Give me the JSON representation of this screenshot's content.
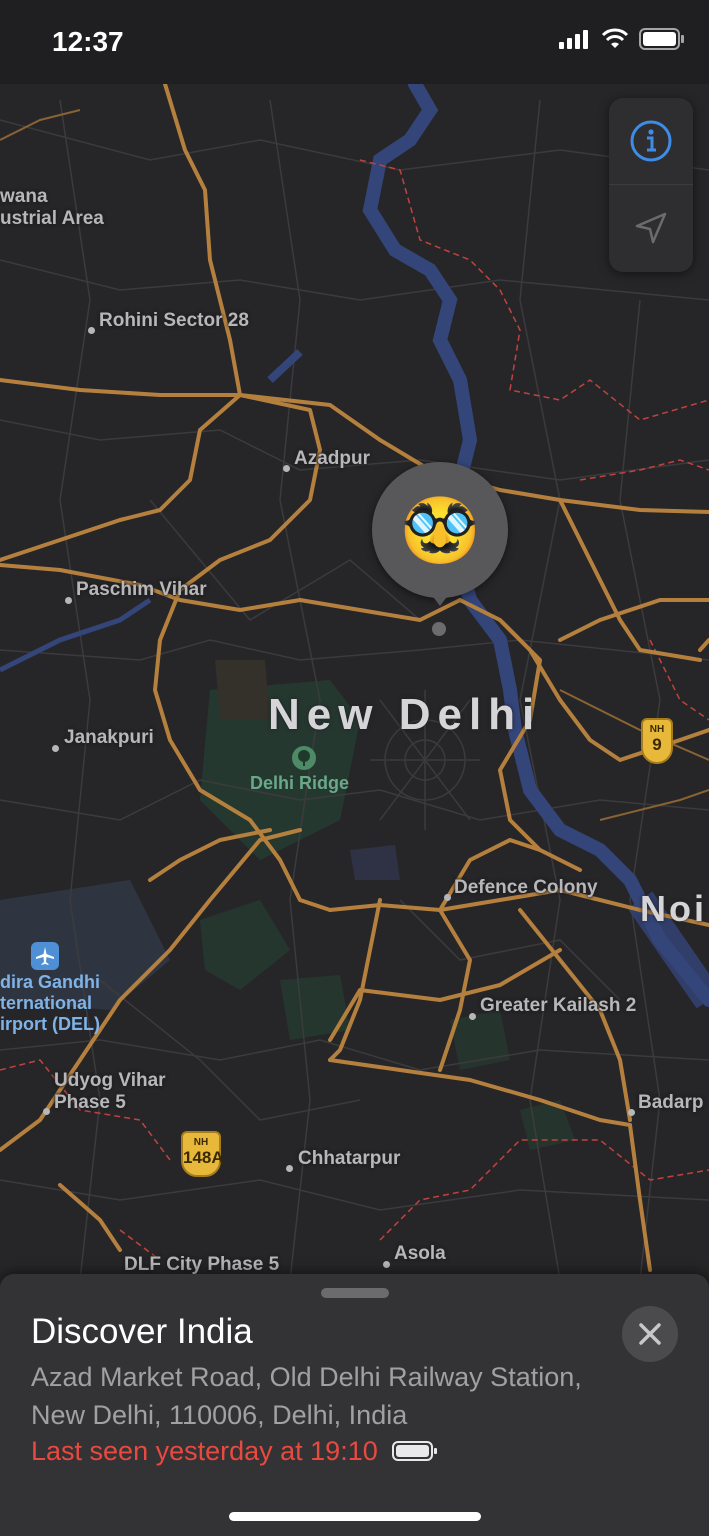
{
  "status_bar": {
    "time": "12:37"
  },
  "map": {
    "city_label": "New Delhi",
    "edge_label": "Noi",
    "places": [
      {
        "name": "wana\nustrial Area"
      },
      {
        "name": "Rohini Sector 28"
      },
      {
        "name": "Azadpur"
      },
      {
        "name": "Paschim Vihar"
      },
      {
        "name": "Janakpuri"
      },
      {
        "name": "Defence Colony"
      },
      {
        "name": "Greater Kailash 2"
      },
      {
        "name": "Udyog Vihar\nPhase 5"
      },
      {
        "name": "Chhatarpur"
      },
      {
        "name": "Badarp"
      },
      {
        "name": "Asola"
      },
      {
        "name": "DLF City Phase 5"
      }
    ],
    "park_label": "Delhi Ridge",
    "airport_label": "dira Gandhi\nternational\nirport (DEL)",
    "highway_shields": [
      {
        "prefix": "NH",
        "number": "9"
      },
      {
        "prefix": "NH",
        "number": "148A"
      }
    ],
    "pin_emoji": "🥸",
    "controls": {
      "info_icon": "info-icon",
      "location_icon": "location-arrow-icon"
    }
  },
  "sheet": {
    "title": "Discover India",
    "address": "Azad Market Road, Old Delhi Railway Station, New Delhi, 110006, Delhi, India",
    "last_seen": "Last seen yesterday at 19:10",
    "close_icon": "close-icon"
  },
  "colors": {
    "road": "#b5803e",
    "river": "#34457a",
    "border": "#c0433f",
    "accent": "#3e8ce6",
    "last_seen": "#e9493e"
  }
}
